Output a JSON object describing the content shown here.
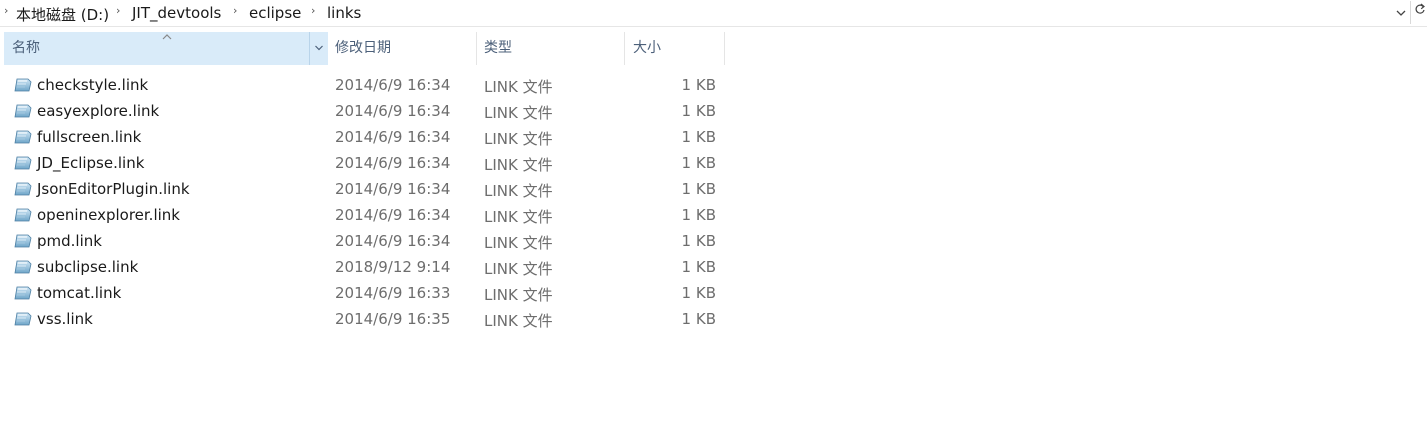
{
  "breadcrumb": {
    "items": [
      "本地磁盘 (D:)",
      "JIT_devtools",
      "eclipse",
      "links"
    ]
  },
  "columns": {
    "name": "名称",
    "date": "修改日期",
    "type": "类型",
    "size": "大小"
  },
  "files": [
    {
      "name": "checkstyle.link",
      "date": "2014/6/9 16:34",
      "type": "LINK 文件",
      "size": "1 KB"
    },
    {
      "name": "easyexplore.link",
      "date": "2014/6/9 16:34",
      "type": "LINK 文件",
      "size": "1 KB"
    },
    {
      "name": "fullscreen.link",
      "date": "2014/6/9 16:34",
      "type": "LINK 文件",
      "size": "1 KB"
    },
    {
      "name": "JD_Eclipse.link",
      "date": "2014/6/9 16:34",
      "type": "LINK 文件",
      "size": "1 KB"
    },
    {
      "name": "JsonEditorPlugin.link",
      "date": "2014/6/9 16:34",
      "type": "LINK 文件",
      "size": "1 KB"
    },
    {
      "name": "openinexplorer.link",
      "date": "2014/6/9 16:34",
      "type": "LINK 文件",
      "size": "1 KB"
    },
    {
      "name": "pmd.link",
      "date": "2014/6/9 16:34",
      "type": "LINK 文件",
      "size": "1 KB"
    },
    {
      "name": "subclipse.link",
      "date": "2018/9/12 9:14",
      "type": "LINK 文件",
      "size": "1 KB"
    },
    {
      "name": "tomcat.link",
      "date": "2014/6/9 16:33",
      "type": "LINK 文件",
      "size": "1 KB"
    },
    {
      "name": "vss.link",
      "date": "2014/6/9 16:35",
      "type": "LINK 文件",
      "size": "1 KB"
    }
  ],
  "icons": {
    "file": "link-file-icon",
    "sort": "sort-ascending-icon",
    "dropdown": "chevron-down-icon",
    "refresh": "refresh-icon"
  },
  "colors": {
    "header_selected_bg": "#d9ebf9",
    "header_text": "#4c607a",
    "detail_text": "#6d6d6d"
  }
}
